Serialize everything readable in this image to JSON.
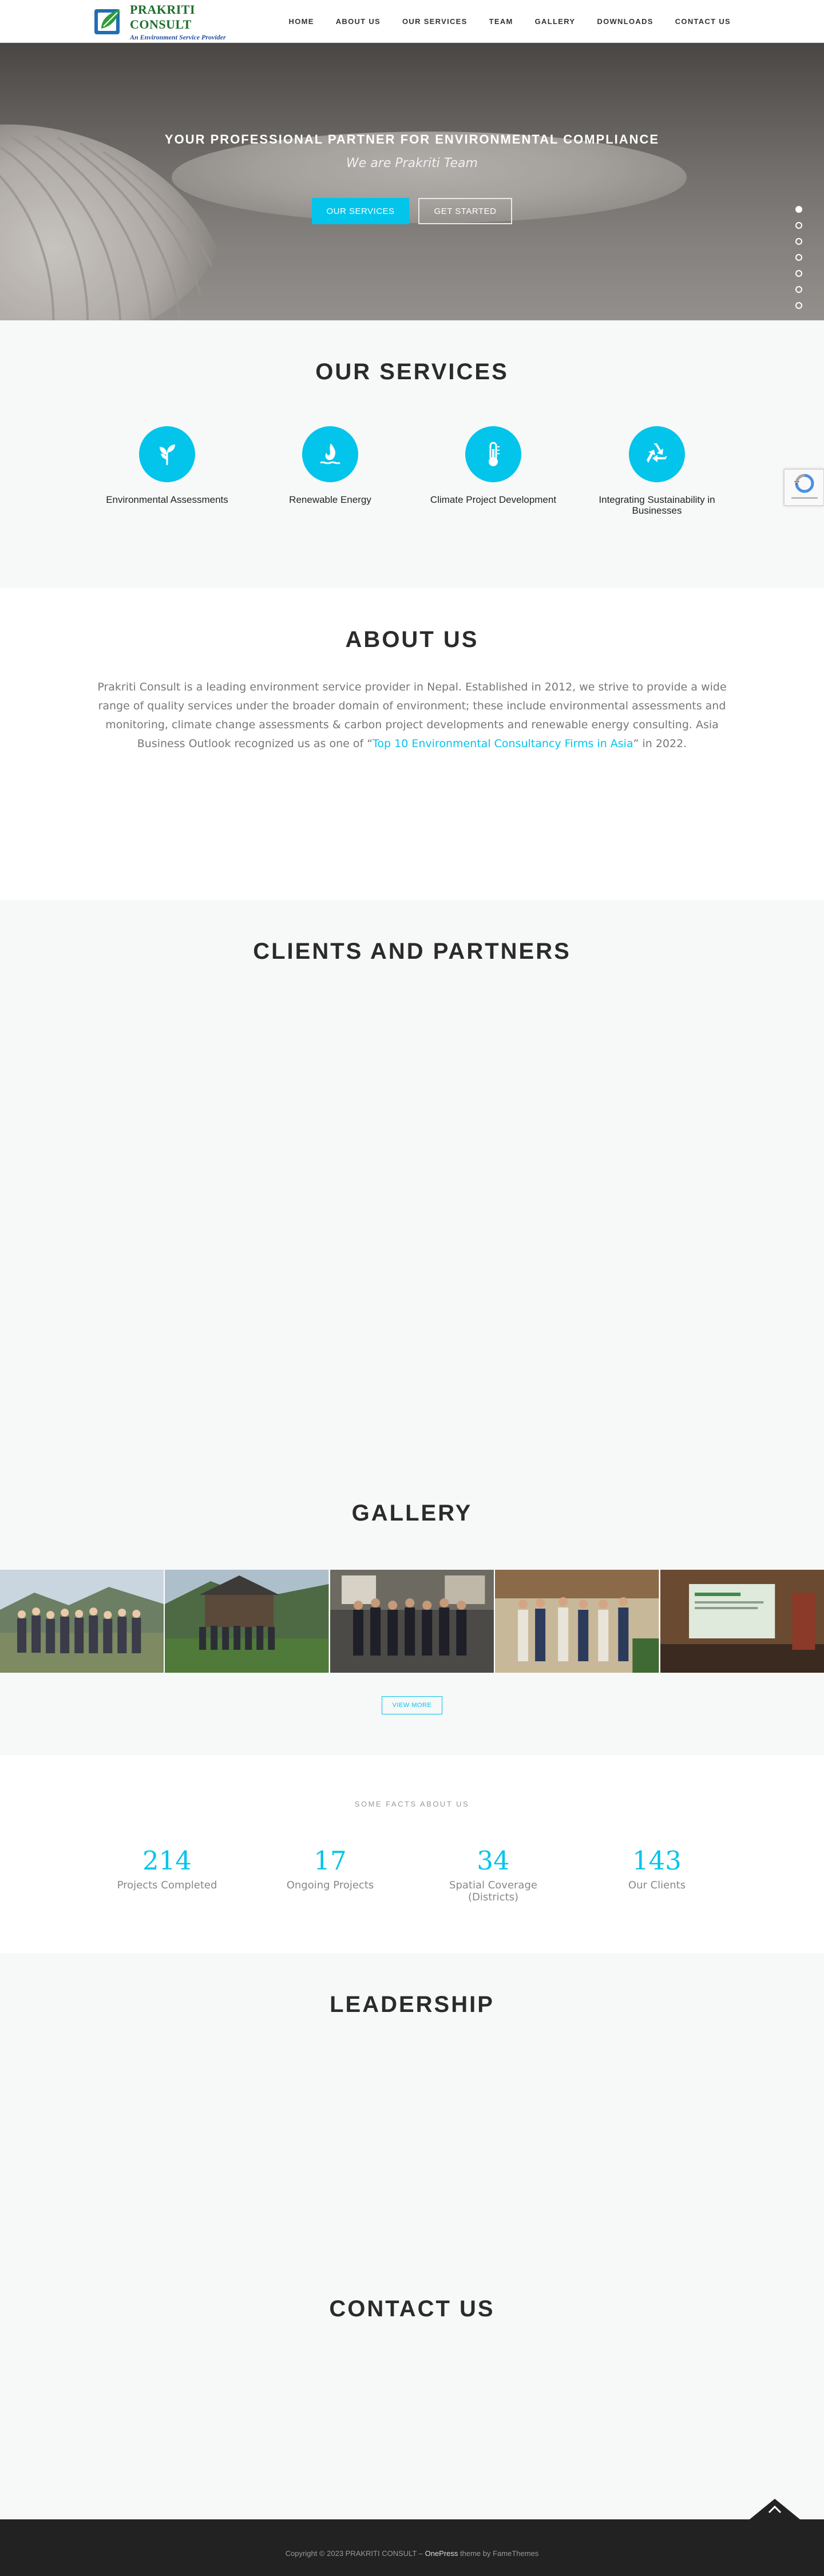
{
  "header": {
    "logo_title": "PRAKRITI CONSULT",
    "logo_subtitle": "An Environment Service Provider",
    "nav": [
      "HOME",
      "ABOUT US",
      "OUR SERVICES",
      "TEAM",
      "GALLERY",
      "DOWNLOADS",
      "CONTACT US"
    ]
  },
  "hero": {
    "title": "YOUR PROFESSIONAL PARTNER FOR ENVIRONMENTAL COMPLIANCE",
    "subtitle": "We are Prakriti Team",
    "primary_button": "OUR SERVICES",
    "secondary_button": "GET STARTED",
    "slide_count": 7,
    "active_slide": 1
  },
  "services": {
    "title": "OUR SERVICES",
    "items": [
      {
        "label": "Environmental Assessments",
        "icon": "sprout-icon"
      },
      {
        "label": "Renewable Energy",
        "icon": "flame-water-icon"
      },
      {
        "label": "Climate Project Development",
        "icon": "thermometer-icon"
      },
      {
        "label": "Integrating Sustainability in Businesses",
        "icon": "recycle-icon"
      }
    ]
  },
  "about": {
    "title": "ABOUT US",
    "text_before": "Prakriti Consult is a leading environment service provider in Nepal. Established in 2012, we strive to provide a wide range of quality services under the broader domain of environment; these include environmental assessments and monitoring, climate change assessments & carbon project developments and renewable energy consulting. Asia Business Outlook recognized us as one of “",
    "link_text": "Top 10 Environmental Consultancy Firms in Asia",
    "text_after": "” in 2022."
  },
  "clients": {
    "title": "CLIENTS AND PARTNERS"
  },
  "gallery": {
    "title": "GALLERY",
    "view_more": "VIEW MORE"
  },
  "facts": {
    "kicker": "SOME FACTS ABOUT US",
    "items": [
      {
        "value": "214",
        "label": "Projects Completed"
      },
      {
        "value": "17",
        "label": "Ongoing Projects"
      },
      {
        "value": "34",
        "label": "Spatial Coverage (Districts)"
      },
      {
        "value": "143",
        "label": "Our Clients"
      }
    ]
  },
  "leadership": {
    "title": "LEADERSHIP"
  },
  "contact": {
    "title": "CONTACT US"
  },
  "footer": {
    "copyright": "Copyright © 2023 PRAKRITI CONSULT – ",
    "theme": "OnePress",
    "suffix": " theme by FameThemes"
  },
  "colors": {
    "accent": "#03c4eb",
    "footer_bg": "#222222",
    "section_alt": "#f7f8f8"
  }
}
